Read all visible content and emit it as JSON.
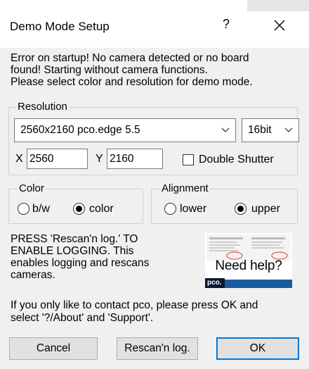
{
  "dialog": {
    "title": "Demo Mode Setup",
    "help_glyph": "?",
    "close_icon": "close-icon"
  },
  "intro": {
    "lines": [
      "Error on startup! No camera detected or no board",
      "found! Starting without camera functions.",
      "Please select color and resolution for demo mode."
    ]
  },
  "resolution": {
    "group_label": "Resolution",
    "camera_select": "2560x2160 pco.edge 5.5",
    "bit_select": "16bit",
    "x_label": "X",
    "x_value": "2560",
    "y_label": "Y",
    "y_value": "2160",
    "double_shutter_label": "Double Shutter",
    "double_shutter_checked": false
  },
  "color": {
    "group_label": "Color",
    "options": [
      "b/w",
      "color"
    ],
    "selected": "color"
  },
  "alignment": {
    "group_label": "Alignment",
    "options": [
      "lower",
      "upper"
    ],
    "selected": "upper"
  },
  "press": {
    "lines": [
      "PRESS 'Rescan'n log.' TO",
      "ENABLE LOGGING. This",
      "enables logging and rescans",
      "cameras."
    ]
  },
  "help_image": {
    "label": "Need help?",
    "brand": "pco."
  },
  "contact": {
    "lines": [
      "If you only like to contact pco, please press OK and",
      "select '?/About' and 'Support'."
    ]
  },
  "buttons": {
    "cancel": "Cancel",
    "rescan": "Rescan'n log.",
    "ok": "OK"
  },
  "colors": {
    "default_button_border": "#0078d7",
    "help_bar": "#1a5a9e"
  }
}
